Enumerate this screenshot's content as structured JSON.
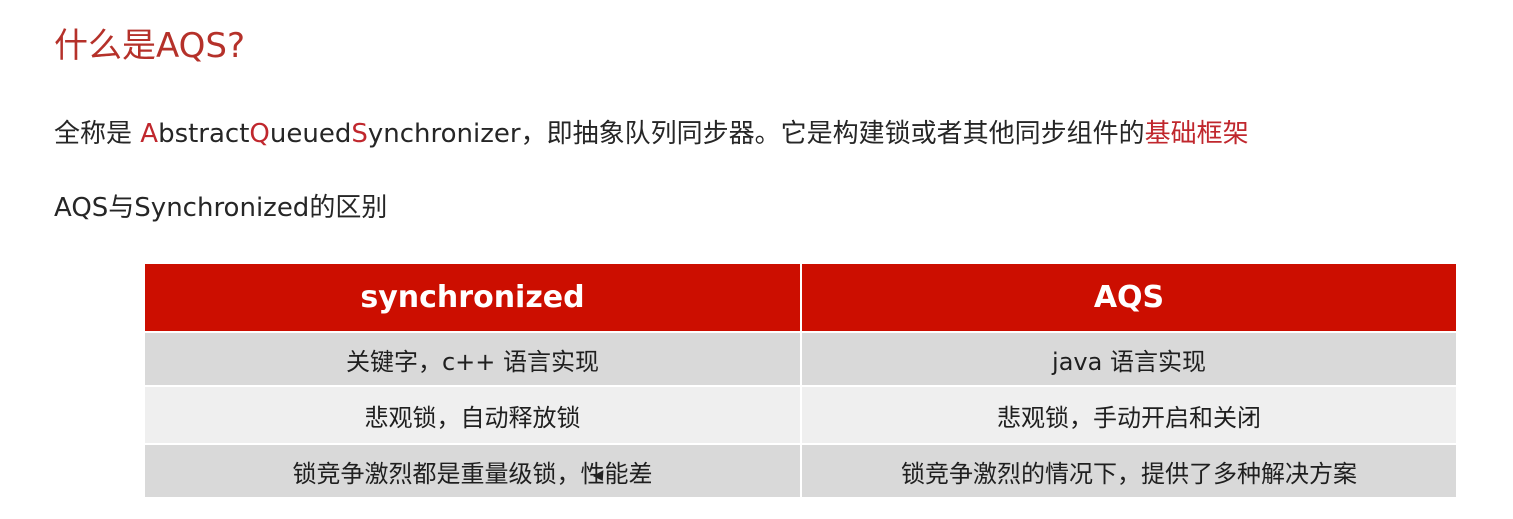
{
  "title": "什么是AQS?",
  "intro": {
    "prefix": "全称是 ",
    "parts": [
      {
        "letter": "A",
        "rest": "bstract"
      },
      {
        "letter": "Q",
        "rest": "ueued"
      },
      {
        "letter": "S",
        "rest": "ynchronizer"
      }
    ],
    "middle": "，即抽象队列同步器。它是构建锁或者其他同步组件的",
    "highlight": "基础框架"
  },
  "subtitle": "AQS与Synchronized的区别",
  "table": {
    "headers": [
      "synchronized",
      "AQS"
    ],
    "rows": [
      [
        "关键字，c++ 语言实现",
        "java 语言实现"
      ],
      [
        "悲观锁，自动释放锁",
        "悲观锁，手动开启和关闭"
      ],
      [
        "锁竞争激烈都是重量级锁，性能差",
        "锁竞争激烈的情况下，提供了多种解决方案"
      ]
    ]
  },
  "colors": {
    "accent": "#b5312a",
    "header_bg": "#cc0e00",
    "row_dark": "#d9d9d9",
    "row_light": "#efefef"
  },
  "icons": {
    "cursor": "mouse-pointer-icon"
  }
}
